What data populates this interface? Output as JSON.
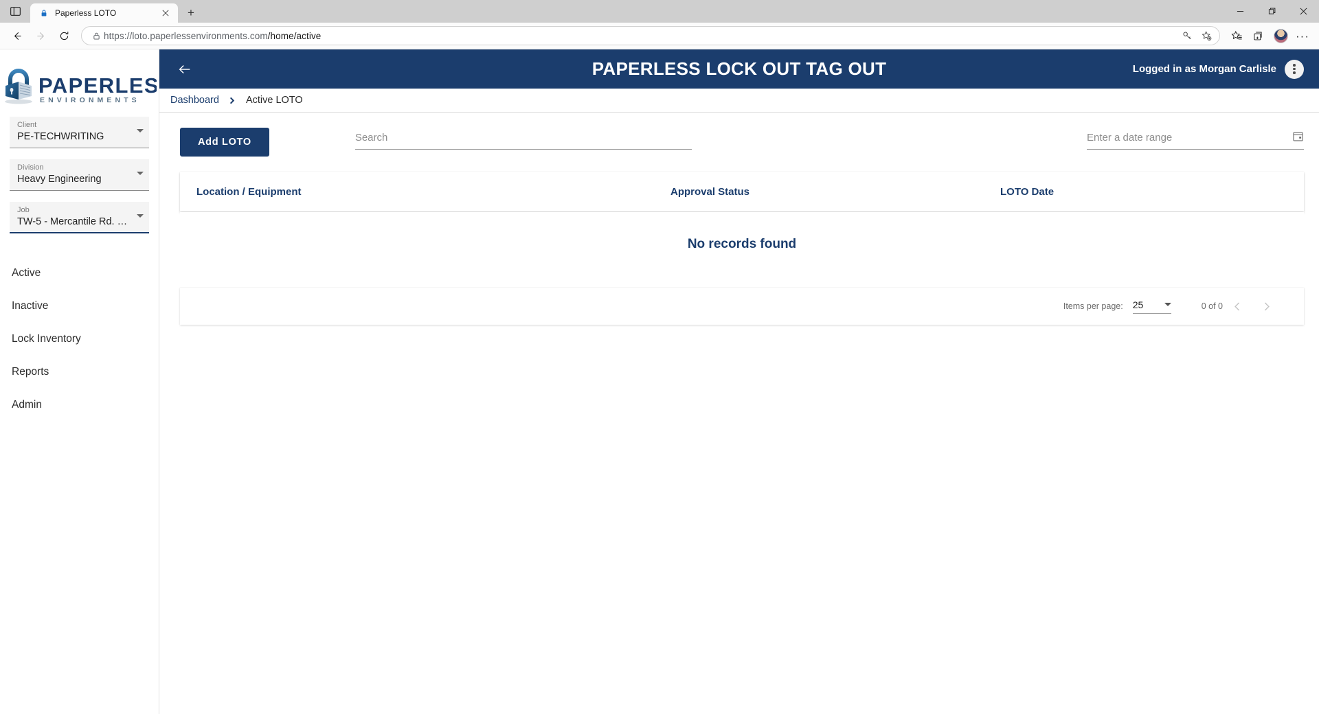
{
  "browser": {
    "tab": {
      "title": "Paperless LOTO",
      "lock_icon": "lock-icon",
      "close_icon": "close-icon"
    },
    "new_tab_label": "+",
    "url_prefix": "https://loto.paperlessenvironments.com",
    "url_path": "/home/active",
    "window_controls": {
      "minimize": "minimize-icon",
      "maximize": "maximize-icon",
      "close": "close-icon"
    },
    "toolbar_icons": [
      "back-arrow-icon",
      "forward-arrow-icon",
      "reload-icon",
      "site-info-lock-icon",
      "key-icon",
      "add-favorite-star-icon",
      "favorites-icon",
      "collections-icon",
      "profile-avatar-icon",
      "settings-ellipsis-icon"
    ]
  },
  "sidebar": {
    "logo": {
      "name": "PAPERLESS",
      "tagline": "ENVIRONMENTS",
      "icon": "padlock-logo-icon"
    },
    "selects": [
      {
        "label": "Client",
        "value": "PE-TECHWRITING",
        "focused": false
      },
      {
        "label": "Division",
        "value": "Heavy Engineering",
        "focused": false
      },
      {
        "label": "Job",
        "value": "TW-5 - Mercantile Rd. R...",
        "focused": true
      }
    ],
    "nav": [
      {
        "label": "Active"
      },
      {
        "label": "Inactive"
      },
      {
        "label": "Lock Inventory"
      },
      {
        "label": "Reports"
      },
      {
        "label": "Admin"
      }
    ]
  },
  "appbar": {
    "back_icon": "back-arrow-icon",
    "title": "PAPERLESS LOCK OUT TAG OUT",
    "user_text": "Logged in as Morgan Carlisle",
    "menu_icon": "kebab-menu-icon"
  },
  "breadcrumb": {
    "parent": "Dashboard",
    "separator_icon": "chevron-right-icon",
    "current": "Active LOTO"
  },
  "toolbar": {
    "add_button": "Add LOTO",
    "search_placeholder": "Search",
    "search_value": "",
    "daterange_placeholder": "Enter a date range",
    "daterange_value": "",
    "calendar_icon": "calendar-icon"
  },
  "table": {
    "columns": [
      "Location / Equipment",
      "Approval Status",
      "LOTO Date"
    ],
    "rows": [],
    "empty_message": "No records found"
  },
  "pagination": {
    "items_per_page_label": "Items per page:",
    "items_per_page_value": "25",
    "range_label": "0 of 0",
    "prev_icon": "chevron-left-icon",
    "next_icon": "chevron-right-icon"
  },
  "colors": {
    "brand_navy": "#1b3d6d",
    "chrome_tabstrip": "#cfcfcf",
    "page_bg": "#ffffff"
  }
}
